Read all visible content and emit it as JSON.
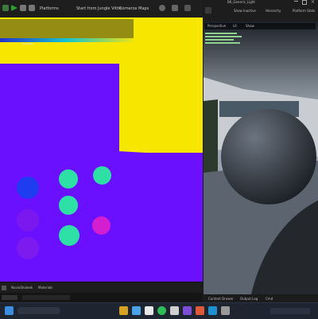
{
  "toolbar": {
    "platforms_label": "Platforms",
    "start_label": "Start from Jungle Vittie",
    "maps_label": "Cornerox Maps"
  },
  "right_panel": {
    "title": "BK_Generic_Light",
    "show_inactive": "Show Inactive",
    "hierarchy": "Hierarchy",
    "platform_stats": "Platform Stats"
  },
  "preview": {
    "mode": "Perspective",
    "lit": "Lit",
    "show": "Show"
  },
  "viewport": {
    "legend_label": "Buy Base"
  },
  "bottom": {
    "tab1": "NavioShaleek",
    "tab2": "Materials",
    "content_drawer": "Content Drawer",
    "output_log": "Output Log",
    "cmd": "Cmd"
  },
  "colors": {
    "viewport_bg": "#6b0fff",
    "yellow": "#f7e600",
    "cyan": "#2ee0a6",
    "blue": "#1f3df0",
    "magenta": "#d41fd1"
  }
}
